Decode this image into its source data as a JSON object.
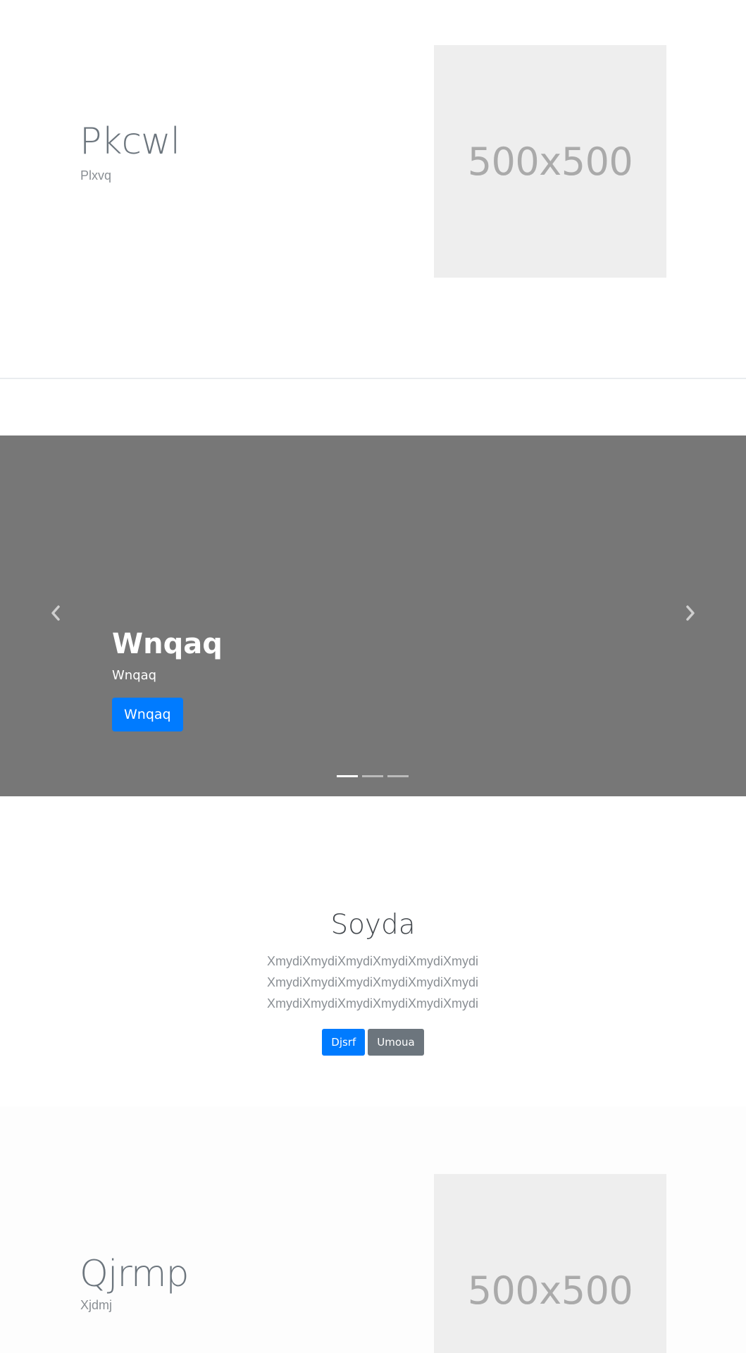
{
  "hero_top": {
    "title": "Pkcwl",
    "subtitle": "Plxvq",
    "image_label": "500x500"
  },
  "carousel": {
    "title": "Wnqaq",
    "subtitle": "Wnqaq",
    "button_label": "Wnqaq",
    "prev_icon": "chevron-left-icon",
    "next_icon": "chevron-right-icon",
    "indicator_count": 3,
    "active_index": 0
  },
  "center_section": {
    "title": "Soyda",
    "paragraph": "XmydiXmydiXmydiXmydiXmydiXmydi XmydiXmydiXmydiXmydiXmydiXmydi XmydiXmydiXmydiXmydiXmydiXmydi",
    "primary_button": "Djsrf",
    "secondary_button": "Umoua"
  },
  "hero_bottom": {
    "title": "Qjrmp",
    "subtitle": "Xjdmj",
    "image_label": "500x500"
  },
  "colors": {
    "primary": "#007bff",
    "secondary": "#6c757d",
    "carousel_bg": "#777777",
    "placeholder_bg": "#eeeeee"
  }
}
